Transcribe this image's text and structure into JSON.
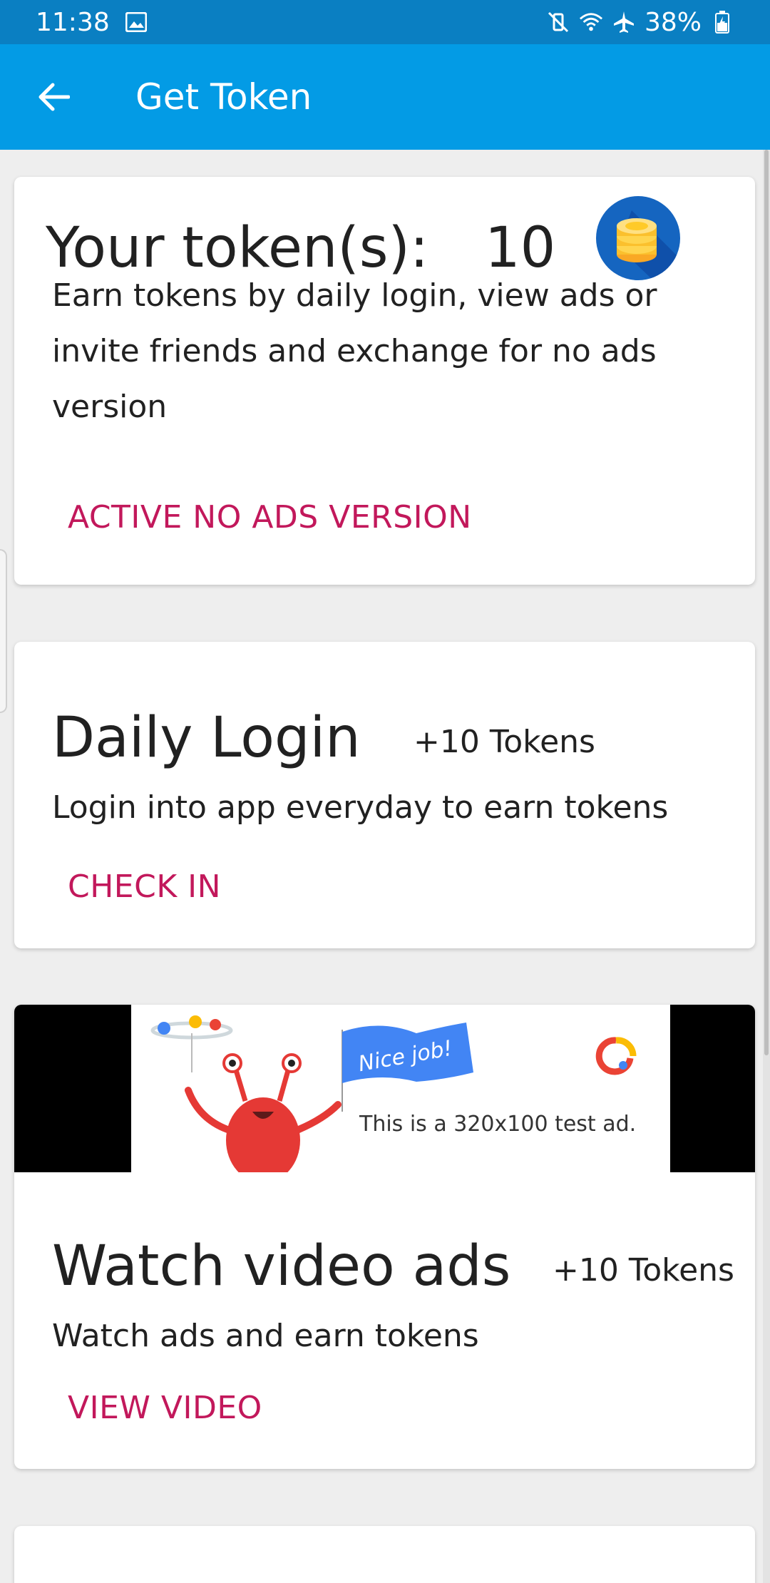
{
  "status_bar": {
    "time": "11:38",
    "battery": "38%",
    "icons": [
      "image-icon",
      "vibrate-mute-icon",
      "wifi-icon",
      "airplane-icon",
      "battery-icon"
    ]
  },
  "app_bar": {
    "title": "Get Token",
    "back_icon": "arrow-back-icon",
    "color": "#039be5"
  },
  "token_card": {
    "label": "Your token(s):",
    "count": "10",
    "coin_icon": "coins-icon",
    "description": "Earn tokens by daily login, view ads or invite friends and exchange for no ads version",
    "action": "ACTIVE NO ADS VERSION"
  },
  "login_card": {
    "title": "Daily Login",
    "reward": "+10 Tokens",
    "description": "Login into app everyday to earn tokens",
    "action": "CHECK IN"
  },
  "video_card": {
    "ad": {
      "badge": "Nice job!",
      "text": "This is a 320x100 test ad."
    },
    "title": "Watch video ads",
    "reward": "+10 Tokens",
    "description": "Watch ads and earn tokens",
    "action": "VIEW VIDEO"
  },
  "colors": {
    "accent": "#c2185b",
    "primary": "#039be5",
    "status_bar": "#0a7fc2"
  }
}
